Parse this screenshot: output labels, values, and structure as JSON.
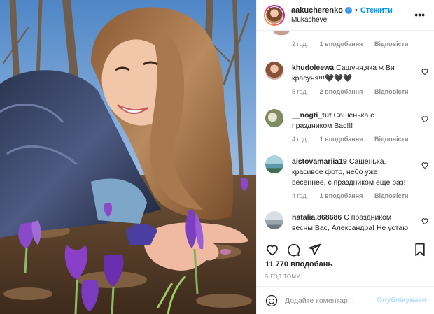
{
  "header": {
    "username": "aakucherenko",
    "separator": "•",
    "follow_label": "Стежити",
    "location": "Mukacheve",
    "more_icon": "more-icon"
  },
  "partial_comment": {
    "time": "2 год.",
    "likes": "1 вподобання",
    "reply": "Відповісти"
  },
  "comments": [
    {
      "user": "khudoleewa",
      "text": "Сашуня,яка ж Ви красуня!!!🖤🖤🖤",
      "time": "5 год.",
      "likes": "2 вподобання",
      "reply": "Відповісти",
      "avatar_color": "#b8755b"
    },
    {
      "user": "__nogti_tut",
      "text": "Сашенька с праздником Вас!!!",
      "time": "4 год.",
      "likes": "1 вподобання",
      "reply": "Відповісти",
      "avatar_color": "#7f8c62"
    },
    {
      "user": "aistovamariia19",
      "text": "Сашенька, красивое фото, небо уже весеннее, с праздником ещё раз!",
      "time": "4 год.",
      "likes": "1 вподобання",
      "reply": "Відповісти",
      "avatar_color": "#5b9aa8"
    },
    {
      "user": "natalia.868686",
      "text": "С праздником весны Вас, Александра! Не устаю",
      "avatar_color": "#c6ccd2"
    }
  ],
  "likes_count": "11 770 вподобань",
  "time_ago": "5 ГОД ТОМУ",
  "add_comment": {
    "placeholder": "Додайте коментар...",
    "publish_label": "Опублікувати"
  },
  "colors": {
    "accent": "#0095f6",
    "publish_disabled": "#b2dffc",
    "muted": "#8e8e8e"
  }
}
